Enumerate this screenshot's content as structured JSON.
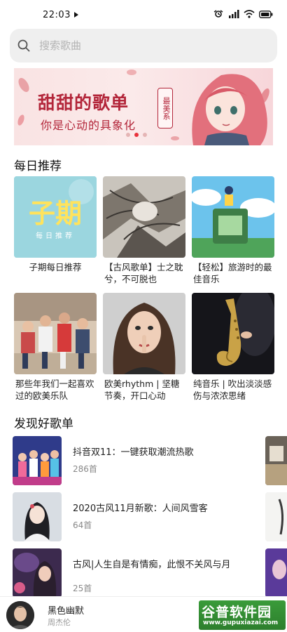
{
  "status_bar": {
    "time": "22:03",
    "icons": [
      "media-play-icon",
      "alarm-icon",
      "signal-icon",
      "wifi-icon",
      "battery-icon"
    ]
  },
  "search": {
    "placeholder": "搜索歌曲"
  },
  "banner": {
    "title": "甜甜的歌单",
    "tag": "最美系",
    "subtitle": "你是心动的具象化",
    "page_count": 3,
    "active_page": 1
  },
  "daily_section": {
    "title": "每日推荐",
    "cards": [
      {
        "caption": "子期每日推荐",
        "cover_text": "子期",
        "cover_subtext": "每日推荐",
        "cover_icon": "text-logo-icon"
      },
      {
        "caption": "【古风歌单】士之耽兮，不可脱也",
        "cover_icon": "ink-sketch-cover-icon"
      },
      {
        "caption": "【轻松】旅游时的最佳音乐",
        "cover_icon": "anime-landscape-cover-icon"
      },
      {
        "caption": "那些年我们一起喜欢过的欧美乐队",
        "cover_icon": "band-photo-cover-icon"
      },
      {
        "caption": "欧美rhythm | 坚糖节奏，开口心动",
        "cover_icon": "portrait-cover-icon"
      },
      {
        "caption": "纯音乐 | 吹出淡淡感伤与浓浓思绪",
        "cover_icon": "saxophone-cover-icon"
      }
    ]
  },
  "discover_section": {
    "title": "发现好歌单",
    "items": [
      {
        "title": "抖音双11：一键获取潮流热歌",
        "count": "286首",
        "cover_icon": "group-photo-cover-icon"
      },
      {
        "title": "2020古风11月新歌：人间风雪客",
        "count": "64首",
        "cover_icon": "hanfu-girl-cover-icon"
      },
      {
        "title": "古风|人生自是有情痴，此恨不关风与月",
        "count": "25首",
        "cover_icon": "fantasy-cover-icon"
      }
    ]
  },
  "player": {
    "song": "黑色幽默",
    "artist": "周杰伦"
  },
  "watermark": {
    "brand": "谷普软件园",
    "url": "www.gupuxiazai.com"
  },
  "colors": {
    "accent": "#e8323c",
    "banner_text": "#b3263a",
    "search_bg": "#efefef",
    "watermark_green": "#2d7f2d"
  }
}
